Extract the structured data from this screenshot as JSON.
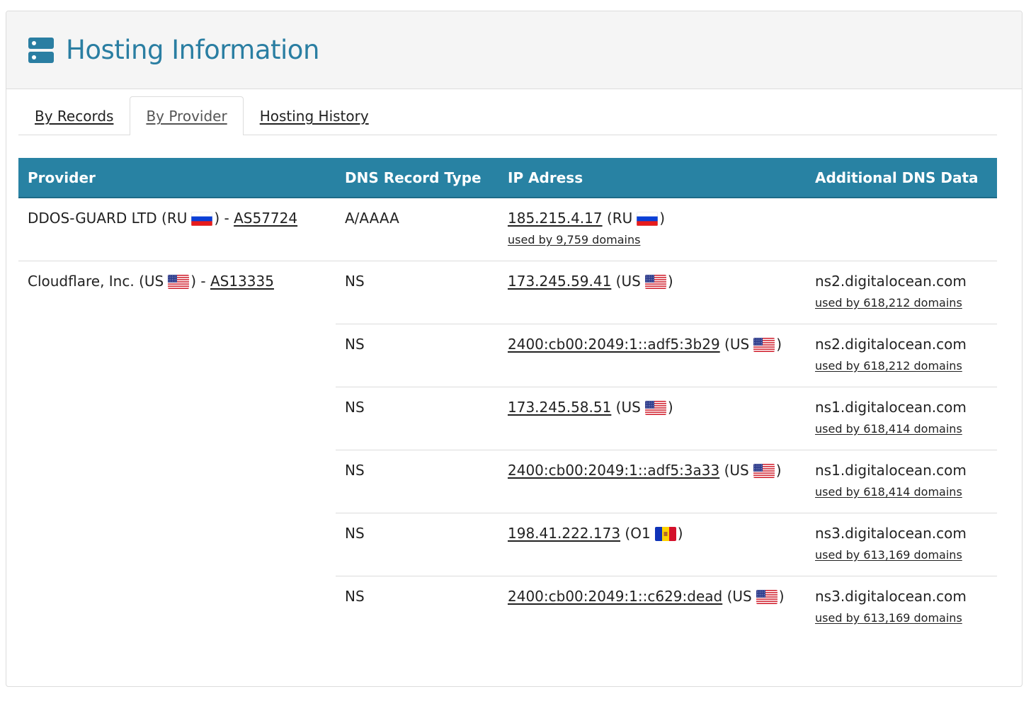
{
  "header": {
    "title": "Hosting Information",
    "icon": "server-icon"
  },
  "tabs": [
    {
      "label": "By Records",
      "active": false
    },
    {
      "label": "By Provider",
      "active": true
    },
    {
      "label": "Hosting History",
      "active": false
    }
  ],
  "table": {
    "headers": [
      "Provider",
      "DNS Record Type",
      "IP Adress",
      "Additional DNS Data"
    ],
    "providers": [
      {
        "name": "DDOS-GUARD LTD (RU",
        "flag": "RU",
        "close": ") - ",
        "asn": "AS57724",
        "records": [
          {
            "type": "A/AAAA",
            "ip": "185.215.4.17",
            "ip_country": " (RU",
            "ip_flag": "RU",
            "ip_close": ")",
            "ip_used": "used by 9,759 domains",
            "dns": "",
            "dns_used": ""
          }
        ]
      },
      {
        "name": "Cloudflare, Inc. (US",
        "flag": "US",
        "close": ") - ",
        "asn": "AS13335",
        "records": [
          {
            "type": "NS",
            "ip": "173.245.59.41",
            "ip_country": " (US",
            "ip_flag": "US",
            "ip_close": ")",
            "ip_used": "",
            "dns": "ns2.digitalocean.com",
            "dns_used": "used by 618,212 domains"
          },
          {
            "type": "NS",
            "ip": "2400:cb00:2049:1::adf5:3b29",
            "ip_country": " (US",
            "ip_flag": "US",
            "ip_close": ")",
            "ip_used": "",
            "dns": "ns2.digitalocean.com",
            "dns_used": "used by 618,212 domains"
          },
          {
            "type": "NS",
            "ip": "173.245.58.51",
            "ip_country": " (US",
            "ip_flag": "US",
            "ip_close": ")",
            "ip_used": "",
            "dns": "ns1.digitalocean.com",
            "dns_used": "used by 618,414 domains"
          },
          {
            "type": "NS",
            "ip": "2400:cb00:2049:1::adf5:3a33",
            "ip_country": " (US",
            "ip_flag": "US",
            "ip_close": ")",
            "ip_used": "",
            "dns": "ns1.digitalocean.com",
            "dns_used": "used by 618,414 domains"
          },
          {
            "type": "NS",
            "ip": "198.41.222.173",
            "ip_country": " (O1",
            "ip_flag": "AD",
            "ip_close": ")",
            "ip_used": "",
            "dns": "ns3.digitalocean.com",
            "dns_used": "used by 613,169 domains"
          },
          {
            "type": "NS",
            "ip": "2400:cb00:2049:1::c629:dead",
            "ip_country": " (US",
            "ip_flag": "US",
            "ip_close": ")",
            "ip_used": "",
            "dns": "ns3.digitalocean.com",
            "dns_used": "used by 613,169 domains"
          }
        ]
      }
    ]
  }
}
